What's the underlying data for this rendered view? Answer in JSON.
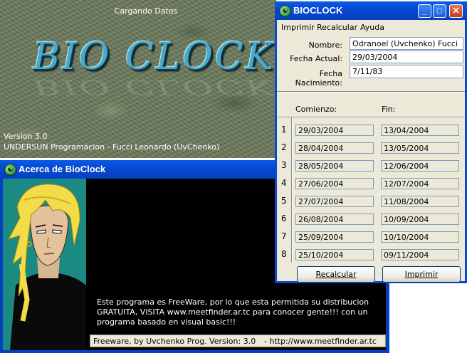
{
  "splash": {
    "status": "Cargando Datos",
    "logo": "BIO CLOCK",
    "version": "Version 3.0",
    "credit": "UNDERSUN Programacion - Fucci Leonardo (UvChenko)"
  },
  "main_window": {
    "title": "BIOCLOCK",
    "icon": "bioclock-app-icon",
    "menu": [
      "Imprimir",
      "Recalcular",
      "Ayuda"
    ],
    "fields": {
      "name_label": "Nombre:",
      "name_value": "Odranoel (Uvchenko) Fucci",
      "date_label": "Fecha Actual:",
      "date_value": "29/03/2004",
      "birth_label": "Fecha Nacimiento:",
      "birth_value": "7/11/83"
    },
    "table": {
      "col_start": "Comienzo:",
      "col_end": "Fin:",
      "rows": [
        {
          "n": "1",
          "start": "29/03/2004",
          "end": "13/04/2004"
        },
        {
          "n": "2",
          "start": "28/04/2004",
          "end": "13/05/2004"
        },
        {
          "n": "3",
          "start": "28/05/2004",
          "end": "12/06/2004"
        },
        {
          "n": "4",
          "start": "27/06/2004",
          "end": "12/07/2004"
        },
        {
          "n": "5",
          "start": "27/07/2004",
          "end": "11/08/2004"
        },
        {
          "n": "6",
          "start": "26/08/2004",
          "end": "10/09/2004"
        },
        {
          "n": "7",
          "start": "25/09/2004",
          "end": "10/10/2004"
        },
        {
          "n": "8",
          "start": "25/10/2004",
          "end": "09/11/2004"
        }
      ]
    },
    "buttons": {
      "recalc": "Recalcular",
      "print": "Imprimir"
    }
  },
  "about_window": {
    "title": "Acerca de BioClock",
    "message": "Este programa es FreeWare, por lo que esta permitida su distribucion GRATUITA, VISITA www.meetfinder.ar.tc para conocer gente!!! con un programa basado en visual basic!!!",
    "status_left": "Freeware, by Uvchenko Prog. Version: 3.0",
    "status_right": "- http://www.meetfinder.ar.tc"
  },
  "colors": {
    "xp_title_blue": "#0649d0",
    "window_face": "#ece9d8",
    "close_red": "#c63a18",
    "portrait_teal": "#1b8a82",
    "logo_blue": "#4aa8c8"
  }
}
